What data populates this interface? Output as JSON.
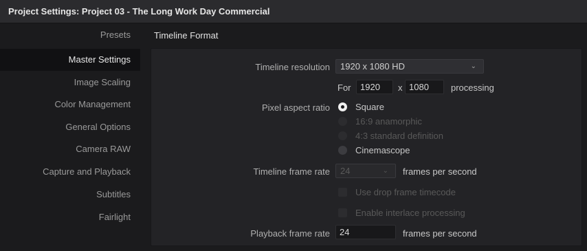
{
  "window": {
    "title": "Project Settings:  Project 03 - The Long Work Day Commercial"
  },
  "sidebar": {
    "items": [
      {
        "label": "Presets"
      },
      {
        "label": "Master Settings"
      },
      {
        "label": "Image Scaling"
      },
      {
        "label": "Color Management"
      },
      {
        "label": "General Options"
      },
      {
        "label": "Camera RAW"
      },
      {
        "label": "Capture and Playback"
      },
      {
        "label": "Subtitles"
      },
      {
        "label": "Fairlight"
      }
    ],
    "active": "Master Settings"
  },
  "section": {
    "title": "Timeline Format"
  },
  "timeline_resolution": {
    "label": "Timeline resolution",
    "value": "1920 x 1080 HD",
    "for_label": "For",
    "width": "1920",
    "x_label": "x",
    "height": "1080",
    "processing_label": "processing"
  },
  "pixel_aspect_ratio": {
    "label": "Pixel aspect ratio",
    "options": [
      {
        "label": "Square",
        "selected": true,
        "enabled": true
      },
      {
        "label": "16:9 anamorphic",
        "selected": false,
        "enabled": false
      },
      {
        "label": "4:3 standard definition",
        "selected": false,
        "enabled": false
      },
      {
        "label": "Cinemascope",
        "selected": false,
        "enabled": true
      }
    ]
  },
  "timeline_frame_rate": {
    "label": "Timeline frame rate",
    "value": "24",
    "unit": "frames per second",
    "enabled": false
  },
  "options": {
    "drop_frame": {
      "label": "Use drop frame timecode",
      "checked": false,
      "enabled": false
    },
    "interlace": {
      "label": "Enable interlace processing",
      "checked": false,
      "enabled": false
    }
  },
  "playback_frame_rate": {
    "label": "Playback frame rate",
    "value": "24",
    "unit": "frames per second"
  },
  "icons": {
    "dropdown_chevron": "chevron-down-icon"
  }
}
